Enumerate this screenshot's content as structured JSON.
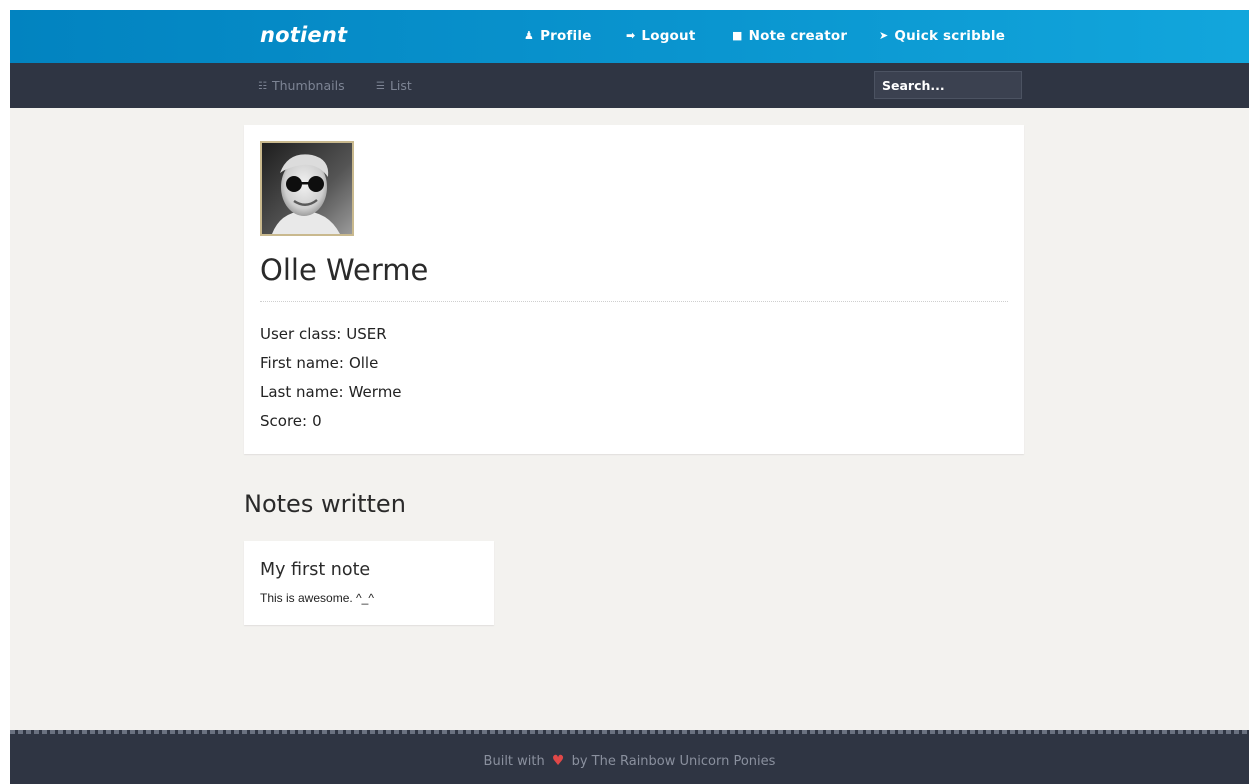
{
  "app": {
    "brand": "notient"
  },
  "nav": {
    "items": [
      {
        "label": "Profile",
        "icon": "user-icon",
        "glyph": "♟"
      },
      {
        "label": "Logout",
        "icon": "logout-icon",
        "glyph": "➡"
      },
      {
        "label": "Note creator",
        "icon": "file-icon",
        "glyph": "■"
      },
      {
        "label": "Quick scribble",
        "icon": "rocket-icon",
        "glyph": "➤"
      }
    ]
  },
  "subnav": {
    "views": [
      {
        "label": "Thumbnails",
        "icon": "grid-icon",
        "glyph": "☷"
      },
      {
        "label": "List",
        "icon": "list-icon",
        "glyph": "☰"
      }
    ],
    "search_placeholder": "Search..."
  },
  "profile": {
    "name": "Olle Werme",
    "fields": [
      {
        "label": "User class:",
        "value": "USER"
      },
      {
        "label": "First name:",
        "value": "Olle"
      },
      {
        "label": "Last name:",
        "value": "Werme"
      },
      {
        "label": "Score:",
        "value": "0"
      }
    ]
  },
  "notes": {
    "heading": "Notes written",
    "items": [
      {
        "title": "My first note",
        "body": "This is awesome. ^_^"
      }
    ]
  },
  "footer": {
    "prefix": "Built with",
    "heart": "♥",
    "suffix": "by The Rainbow Unicorn Ponies"
  },
  "colors": {
    "topbar": "#0a95cf",
    "subbar": "#2f3543",
    "background": "#f3f2ef",
    "heart": "#e04848"
  }
}
